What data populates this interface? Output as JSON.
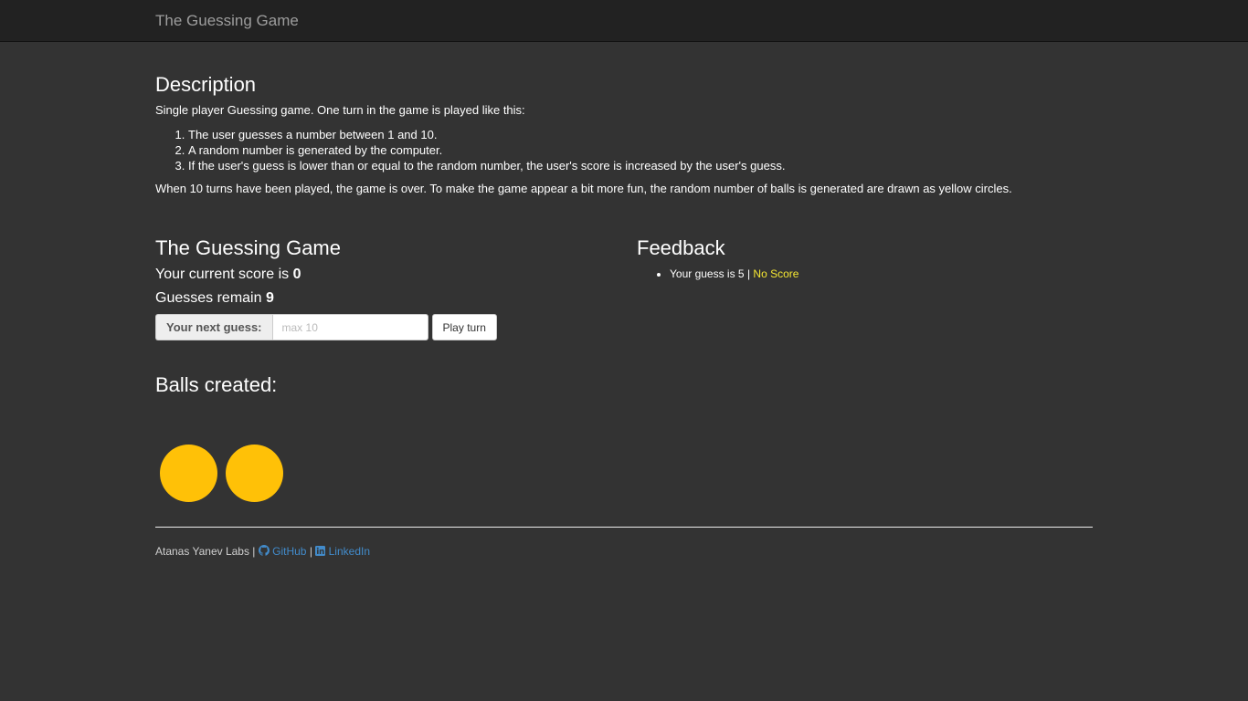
{
  "navbar": {
    "brand": "The Guessing Game"
  },
  "description": {
    "title": "Description",
    "intro": "Single player Guessing game. One turn in the game is played like this:",
    "steps": [
      "The user guesses a number between 1 and 10.",
      "A random number is generated by the computer.",
      "If the user's guess is lower than or equal to the random number, the user's score is increased by the user's guess."
    ],
    "outro": "When 10 turns have been played, the game is over. To make the game appear a bit more fun, the random number of balls is generated are drawn as yellow circles."
  },
  "game": {
    "title": "The Guessing Game",
    "score_label": "Your current score is",
    "score_value": "0",
    "remain_label": "Guesses remain",
    "remain_value": "9",
    "guess_label": "Your next guess:",
    "guess_placeholder": "max 10",
    "play_button": "Play turn"
  },
  "feedback": {
    "title": "Feedback",
    "items": [
      {
        "text": "Your guess is 5 |",
        "result": "No Score"
      }
    ]
  },
  "balls": {
    "title": "Balls created:",
    "count": 2,
    "color": "#ffc107"
  },
  "footer": {
    "author": "Atanas Yanev Labs |",
    "separator": "|",
    "github": "GitHub",
    "linkedin": "LinkedIn",
    "github_icon": "github-icon",
    "linkedin_icon": "linkedin-icon"
  },
  "colors": {
    "background": "#333333",
    "navbar": "#222222",
    "link": "#428bca",
    "no_score": "#f5e733"
  }
}
